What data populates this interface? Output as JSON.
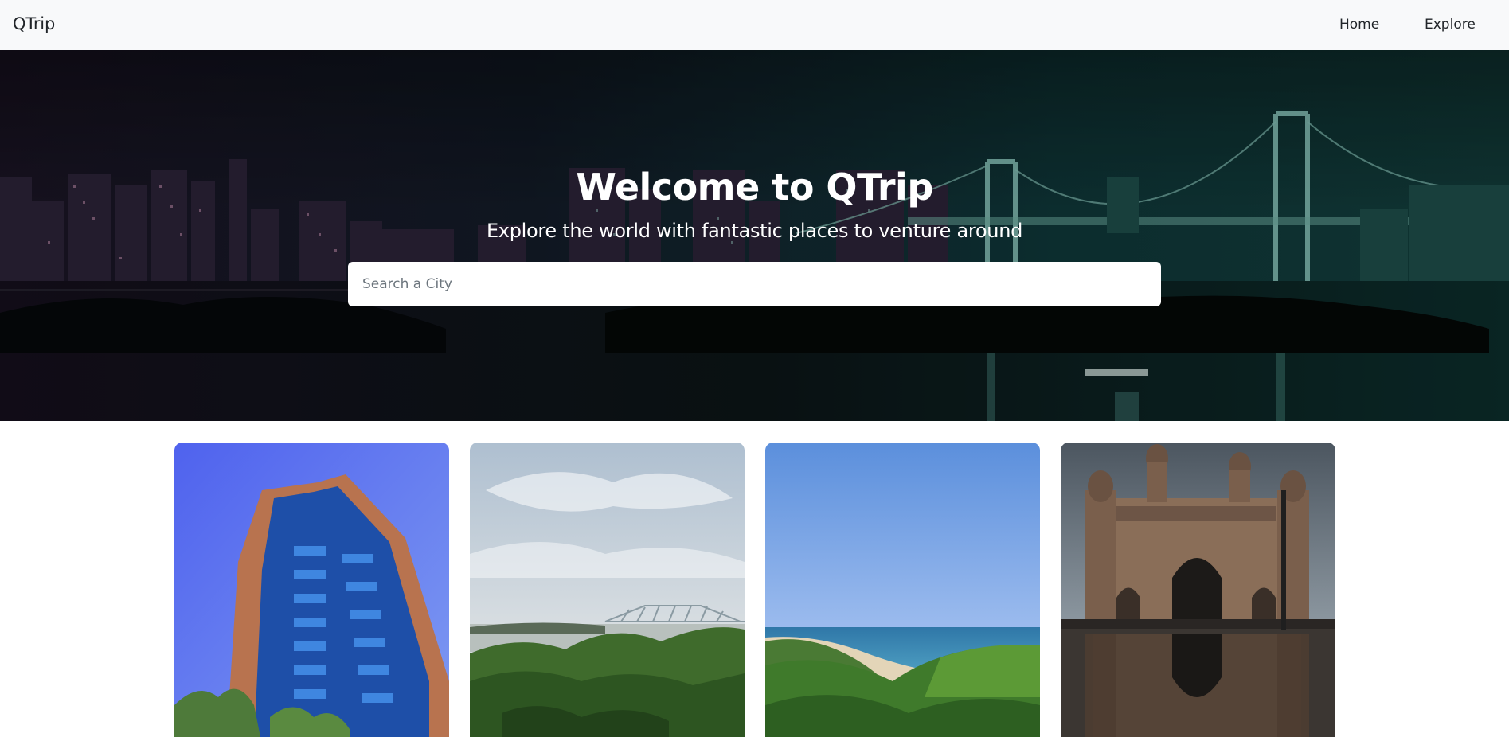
{
  "navbar": {
    "brand": "QTrip",
    "links": [
      {
        "label": "Home"
      },
      {
        "label": "Explore"
      }
    ]
  },
  "hero": {
    "title": "Welcome to QTrip",
    "subtitle": "Explore the world with fantastic places to venture around",
    "search": {
      "placeholder": "Search a City",
      "value": ""
    }
  },
  "colors": {
    "navbar_bg": "#f8f9fa",
    "hero_overlay": "#0b2a33",
    "text_light": "#ffffff"
  },
  "cities": [
    {
      "image": "glass-office-tower"
    },
    {
      "image": "river-bridge-greenery"
    },
    {
      "image": "sea-coast-view"
    },
    {
      "image": "gateway-monument"
    }
  ]
}
